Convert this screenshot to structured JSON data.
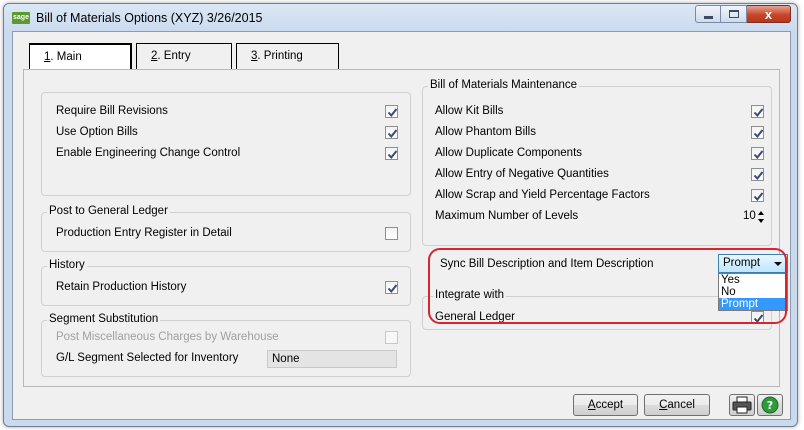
{
  "window": {
    "logo_text": "sage",
    "title": "Bill of Materials Options (XYZ) 3/26/2015",
    "close_glyph": "x"
  },
  "tabs": [
    {
      "key": "1",
      "label": ". Main"
    },
    {
      "key": "2",
      "label": ". Entry"
    },
    {
      "key": "3",
      "label": ". Printing"
    }
  ],
  "left": {
    "general_rows": [
      {
        "label": "Require Bill Revisions",
        "checked": true
      },
      {
        "label": "Use Option Bills",
        "checked": true
      },
      {
        "label": "Enable Engineering Change Control",
        "checked": true
      }
    ],
    "post_gl": {
      "title": "Post to General Ledger",
      "row": {
        "label": "Production Entry Register in Detail",
        "checked": false
      }
    },
    "history": {
      "title": "History",
      "row": {
        "label": "Retain Production History",
        "checked": true
      }
    },
    "segment": {
      "title": "Segment Substitution",
      "row": {
        "label": "Post Miscellaneous Charges by Warehouse",
        "checked": false,
        "disabled": true
      },
      "gl_segment_label": "G/L Segment Selected for Inventory",
      "gl_segment_value": "None"
    }
  },
  "right": {
    "title": "Bill of Materials Maintenance",
    "rows": [
      {
        "label": "Allow Kit Bills",
        "checked": true
      },
      {
        "label": "Allow Phantom Bills",
        "checked": true
      },
      {
        "label": "Allow Duplicate Components",
        "checked": true
      },
      {
        "label": "Allow Entry of Negative Quantities",
        "checked": true
      },
      {
        "label": "Allow Scrap and Yield Percentage Factors",
        "checked": true
      }
    ],
    "max_levels_label": "Maximum Number of Levels",
    "max_levels_value": "10",
    "sync_label": "Sync Bill Description and Item Description",
    "sync_value": "Prompt",
    "sync_options": [
      "Yes",
      "No",
      "Prompt"
    ],
    "integrate_title": "Integrate with",
    "general_ledger_label": "General Ledger"
  },
  "buttons": {
    "accept_key": "A",
    "accept_rest": "ccept",
    "cancel_key": "C",
    "cancel_rest": "ancel"
  },
  "colors": {
    "highlight": "#d6252e",
    "dropdown_selected": "#3399ff"
  }
}
